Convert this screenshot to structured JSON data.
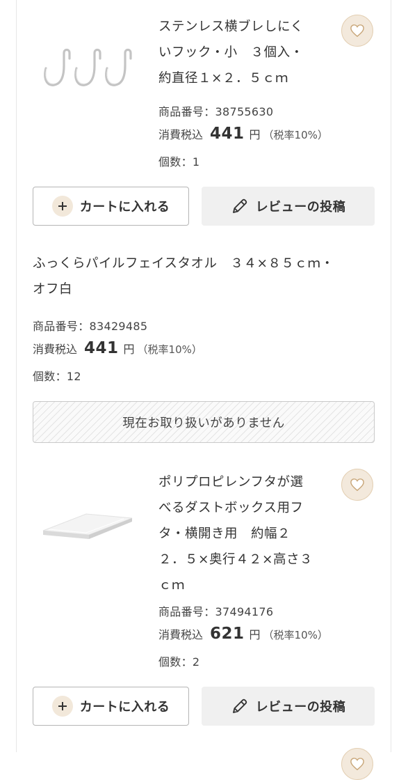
{
  "labels": {
    "item_no": "商品番号：",
    "price_prefix": "消費税込",
    "yen": "円",
    "tax_note": "（税率10%）",
    "qty": "個数：",
    "add_to_cart": "カートに入れる",
    "write_review": "レビューの投稿",
    "unavailable": "現在お取り扱いがありません"
  },
  "items": [
    {
      "title_lines": [
        "ステンレス横ブレしにく",
        "いフック・小　３個入・",
        "約直径１×２．５ｃｍ"
      ],
      "item_no": "38755630",
      "price": "441",
      "qty": "1",
      "image": "stainless-hooks-image"
    },
    {
      "title_lines": [
        "ふっくらパイルフェイスタオル　３４×８５ｃｍ・",
        "オフ白"
      ],
      "item_no": "83429485",
      "price": "441",
      "qty": "12"
    },
    {
      "title_lines": [
        "ポリプロピレンフタが選",
        "べるダストボックス用フ",
        "タ・横開き用　約幅２",
        "２．５×奥行４２×高さ３",
        "ｃｍ"
      ],
      "item_no": "37494176",
      "price": "621",
      "qty": "2",
      "image": "dustbox-lid-image"
    }
  ],
  "colors": {
    "heart_bg": "#f3e9dc",
    "heart_stroke": "#c9a77a",
    "plus_bg": "#f2e8da",
    "review_bg": "#f0f0f0"
  },
  "icons": {
    "favorite": "heart-icon",
    "add": "plus-icon",
    "review": "pencil-icon"
  }
}
